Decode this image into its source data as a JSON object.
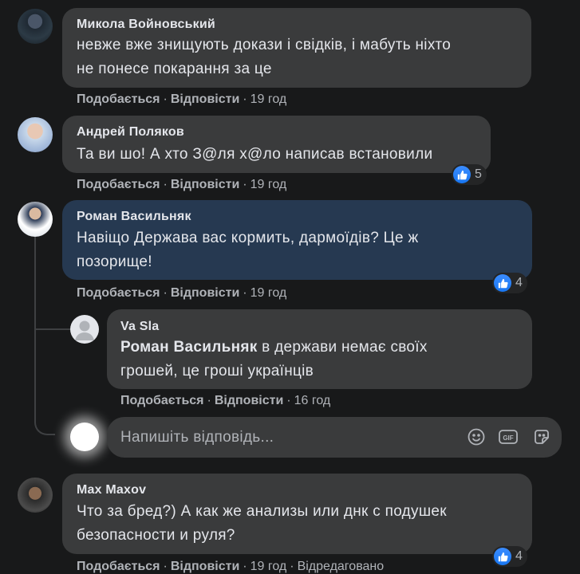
{
  "comments": [
    {
      "author": "Микола Войновський",
      "line1": "невже вже знищують докази і свідків, і мабуть ніхто",
      "line2": "не понесе покарання за це",
      "like": "Подобається",
      "reply": "Відповісти",
      "time": "19 год"
    },
    {
      "author": "Андрей Поляков",
      "line1": "Та ви шо! А хто З@ля х@ло написав встановили",
      "like": "Подобається",
      "reply": "Відповісти",
      "time": "19 год",
      "reactions": "5"
    },
    {
      "author": "Роман Васильняк",
      "line1": "Навіщо Держава вас кормить, дармоїдів? Це ж",
      "line2": "позорище!",
      "like": "Подобається",
      "reply": "Відповісти",
      "time": "19 год",
      "reactions": "4"
    },
    {
      "author": "Va Sla",
      "mention": "Роман Васильняк",
      "line1_rest": " в держави немає своїх",
      "line2": "грошей, це гроші українців",
      "like": "Подобається",
      "reply": "Відповісти",
      "time": "16 год"
    },
    {
      "author": "Max Maxov",
      "line1": "Что за бред?) А как же анализы или днк с подушек",
      "line2": "безопасности и руля?",
      "like": "Подобається",
      "reply": "Відповісти",
      "time": "19 год",
      "edited": "Відредаговано",
      "reactions": "4"
    }
  ],
  "reply_box": {
    "placeholder": "Напишіть відповідь..."
  },
  "icons": {
    "emoji": "smiley-icon",
    "gif": "gif-icon",
    "sticker": "sticker-icon",
    "like": "thumbs-up-icon"
  },
  "colors": {
    "background": "#18191a",
    "bubble": "#3a3b3c",
    "highlight_bubble": "#263951",
    "like_blue": "#1877f2",
    "secondary_text": "#b0b3b8"
  }
}
